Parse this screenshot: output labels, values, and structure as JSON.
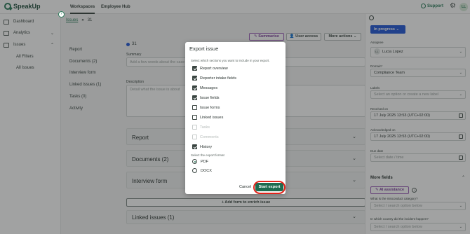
{
  "app": {
    "logo": "SpeakUp",
    "tabs": [
      "Workspaces",
      "Employee Hub"
    ],
    "support_label": "Support",
    "avatar": "LL"
  },
  "sidebar": {
    "items": [
      {
        "label": "Dashboard",
        "icon": "grid-icon"
      },
      {
        "label": "Analytics",
        "icon": "chart-icon"
      },
      {
        "label": "Issues",
        "icon": "issues-icon"
      }
    ],
    "issues_sub": [
      "All Filters",
      "All Issues"
    ],
    "collapse_glyph": "›"
  },
  "breadcrumb": {
    "root": "Issues",
    "sep": "»",
    "current": "31"
  },
  "toolbar": {
    "summarise": "Summarise",
    "user_access": "User access",
    "more_actions": "More actions"
  },
  "issue": {
    "id": "31"
  },
  "tabs_nav": [
    "Report",
    "Documents (2)",
    "Interview form",
    "Linked issues (1)",
    "Tasks (0)",
    "Activity"
  ],
  "form": {
    "summary_label": "Summary",
    "summary_placeholder": "Add a few words about the case",
    "description_label": "Description",
    "description_placeholder": "Detail what the issue is about"
  },
  "sections": [
    "Report",
    "Documents (2)",
    "Interview form",
    "Linked issues (1)"
  ],
  "add_form_label": "+ Add form to enrich issue",
  "right_panel": {
    "status": "In progress",
    "assignee_label": "Assignee",
    "assignee_name": "Lucia Lopez",
    "assignee_initials": "LL",
    "domain_label": "Domain*",
    "domain_value": "Compliance Team",
    "labels_label": "Labels",
    "labels_placeholder": "Select an option or create a new label",
    "received_label": "Received on",
    "received_value": "17 July 2025 13:53 (UTC+02:00)",
    "ack_label": "Acknowledged on",
    "ack_value": "17 July 2025 13:53 (UTC+02:00)",
    "due_label": "Due date",
    "due_placeholder": "Select date / time",
    "more_fields": "More fields",
    "ai_assistance": "AI assistance",
    "q1_label": "What is the misconduct category?",
    "q1_placeholder": "Select / search option below",
    "q2_label": "In which country did the incident happen?",
    "q2_placeholder": "Select / search option below"
  },
  "modal": {
    "title": "Export issue",
    "subtitle": "Select which sections you want to include in your export.",
    "options": [
      {
        "label": "Report overview",
        "checked": true,
        "disabled": false
      },
      {
        "label": "Reporter intake fields",
        "checked": true,
        "disabled": false
      },
      {
        "label": "Messages",
        "checked": true,
        "disabled": false
      },
      {
        "label": "Issue fields",
        "checked": true,
        "disabled": false
      },
      {
        "label": "Issue forms",
        "checked": false,
        "disabled": false
      },
      {
        "label": "Linked issues",
        "checked": false,
        "disabled": false
      },
      {
        "label": "Tasks",
        "checked": false,
        "disabled": true
      },
      {
        "label": "Comments",
        "checked": false,
        "disabled": true
      },
      {
        "label": "History",
        "checked": true,
        "disabled": false
      }
    ],
    "format_label": "Select the export format",
    "formats": [
      {
        "label": "PDF",
        "selected": true
      },
      {
        "label": "DOCX",
        "selected": false
      }
    ],
    "cancel_label": "Cancel",
    "export_label": "Start export"
  },
  "colors": {
    "accent_green": "#1e6b4f",
    "status_blue": "#2458d8",
    "highlight_red": "#e2231a",
    "ai_purple": "#9b5eb8"
  }
}
